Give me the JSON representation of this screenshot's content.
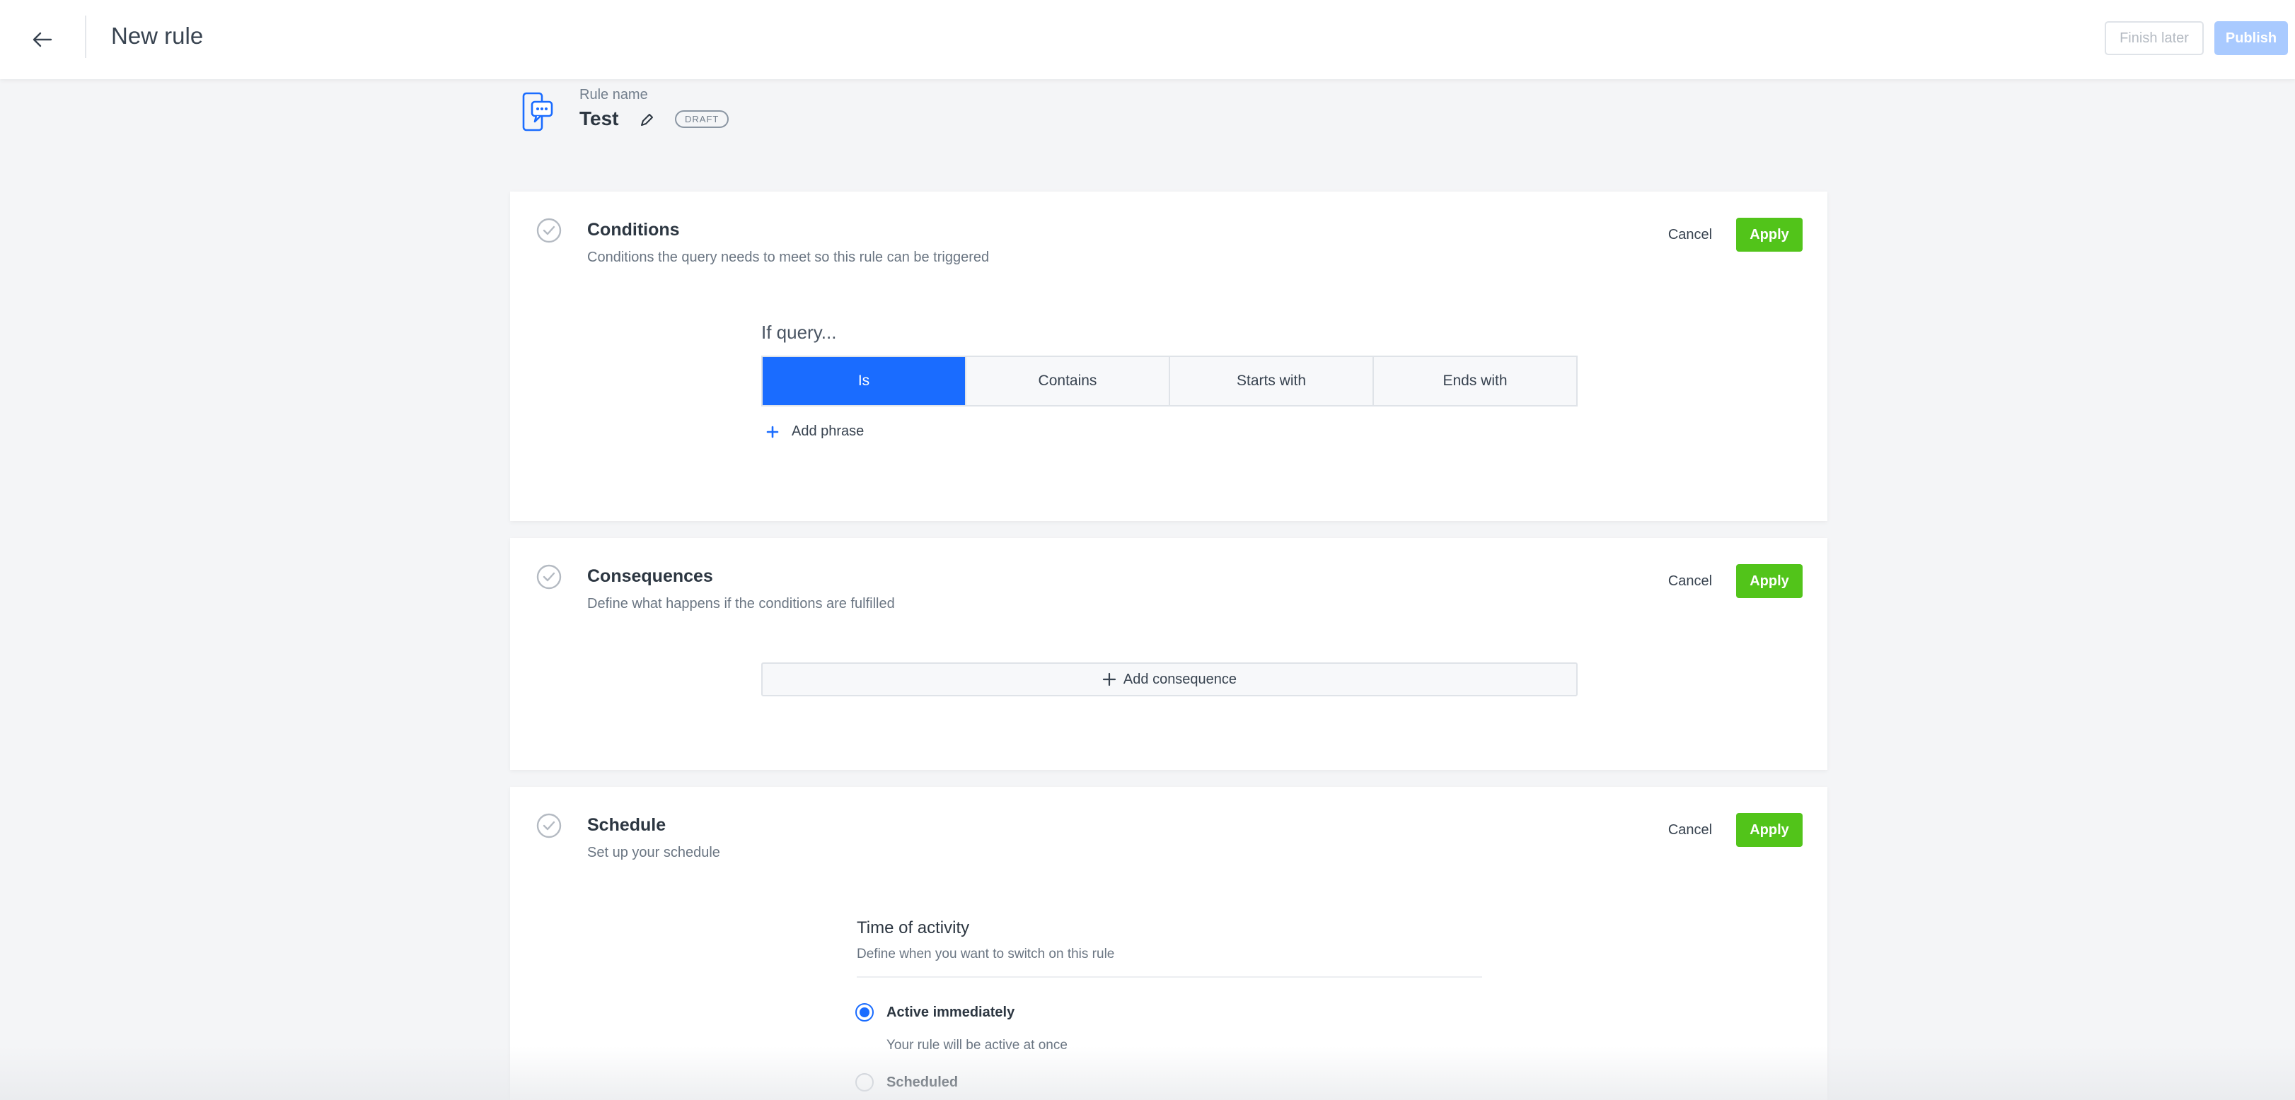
{
  "header": {
    "title": "New rule",
    "finish_later_label": "Finish later",
    "publish_label": "Publish"
  },
  "rule": {
    "name_label": "Rule name",
    "name": "Test",
    "status_badge": "DRAFT"
  },
  "conditions": {
    "title": "Conditions",
    "subtitle": "Conditions the query needs to meet so this rule can be triggered",
    "cancel_label": "Cancel",
    "apply_label": "Apply",
    "if_query_label": "If query...",
    "match_options": [
      {
        "label": "Is",
        "selected": true
      },
      {
        "label": "Contains",
        "selected": false
      },
      {
        "label": "Starts with",
        "selected": false
      },
      {
        "label": "Ends with",
        "selected": false
      }
    ],
    "add_phrase_label": "Add phrase"
  },
  "consequences": {
    "title": "Consequences",
    "subtitle": "Define what happens if the conditions are fulfilled",
    "cancel_label": "Cancel",
    "apply_label": "Apply",
    "add_consequence_label": "Add consequence"
  },
  "schedule": {
    "title": "Schedule",
    "subtitle": "Set up your schedule",
    "cancel_label": "Cancel",
    "apply_label": "Apply",
    "time_of_activity_title": "Time of activity",
    "time_of_activity_subtitle": "Define when you want to switch on this rule",
    "options": [
      {
        "label": "Active immediately",
        "description": "Your rule will be active at once",
        "checked": true
      },
      {
        "label": "Scheduled",
        "checked": false
      }
    ]
  },
  "colors": {
    "primary_blue": "#1a6cff",
    "apply_green": "#52c41a",
    "publish_disabled": "#a9caff",
    "background": "#f4f5f7"
  },
  "icons": [
    "back-arrow-icon",
    "rule-chat-icon",
    "pencil-icon",
    "check-circle-icon",
    "plus-icon"
  ]
}
